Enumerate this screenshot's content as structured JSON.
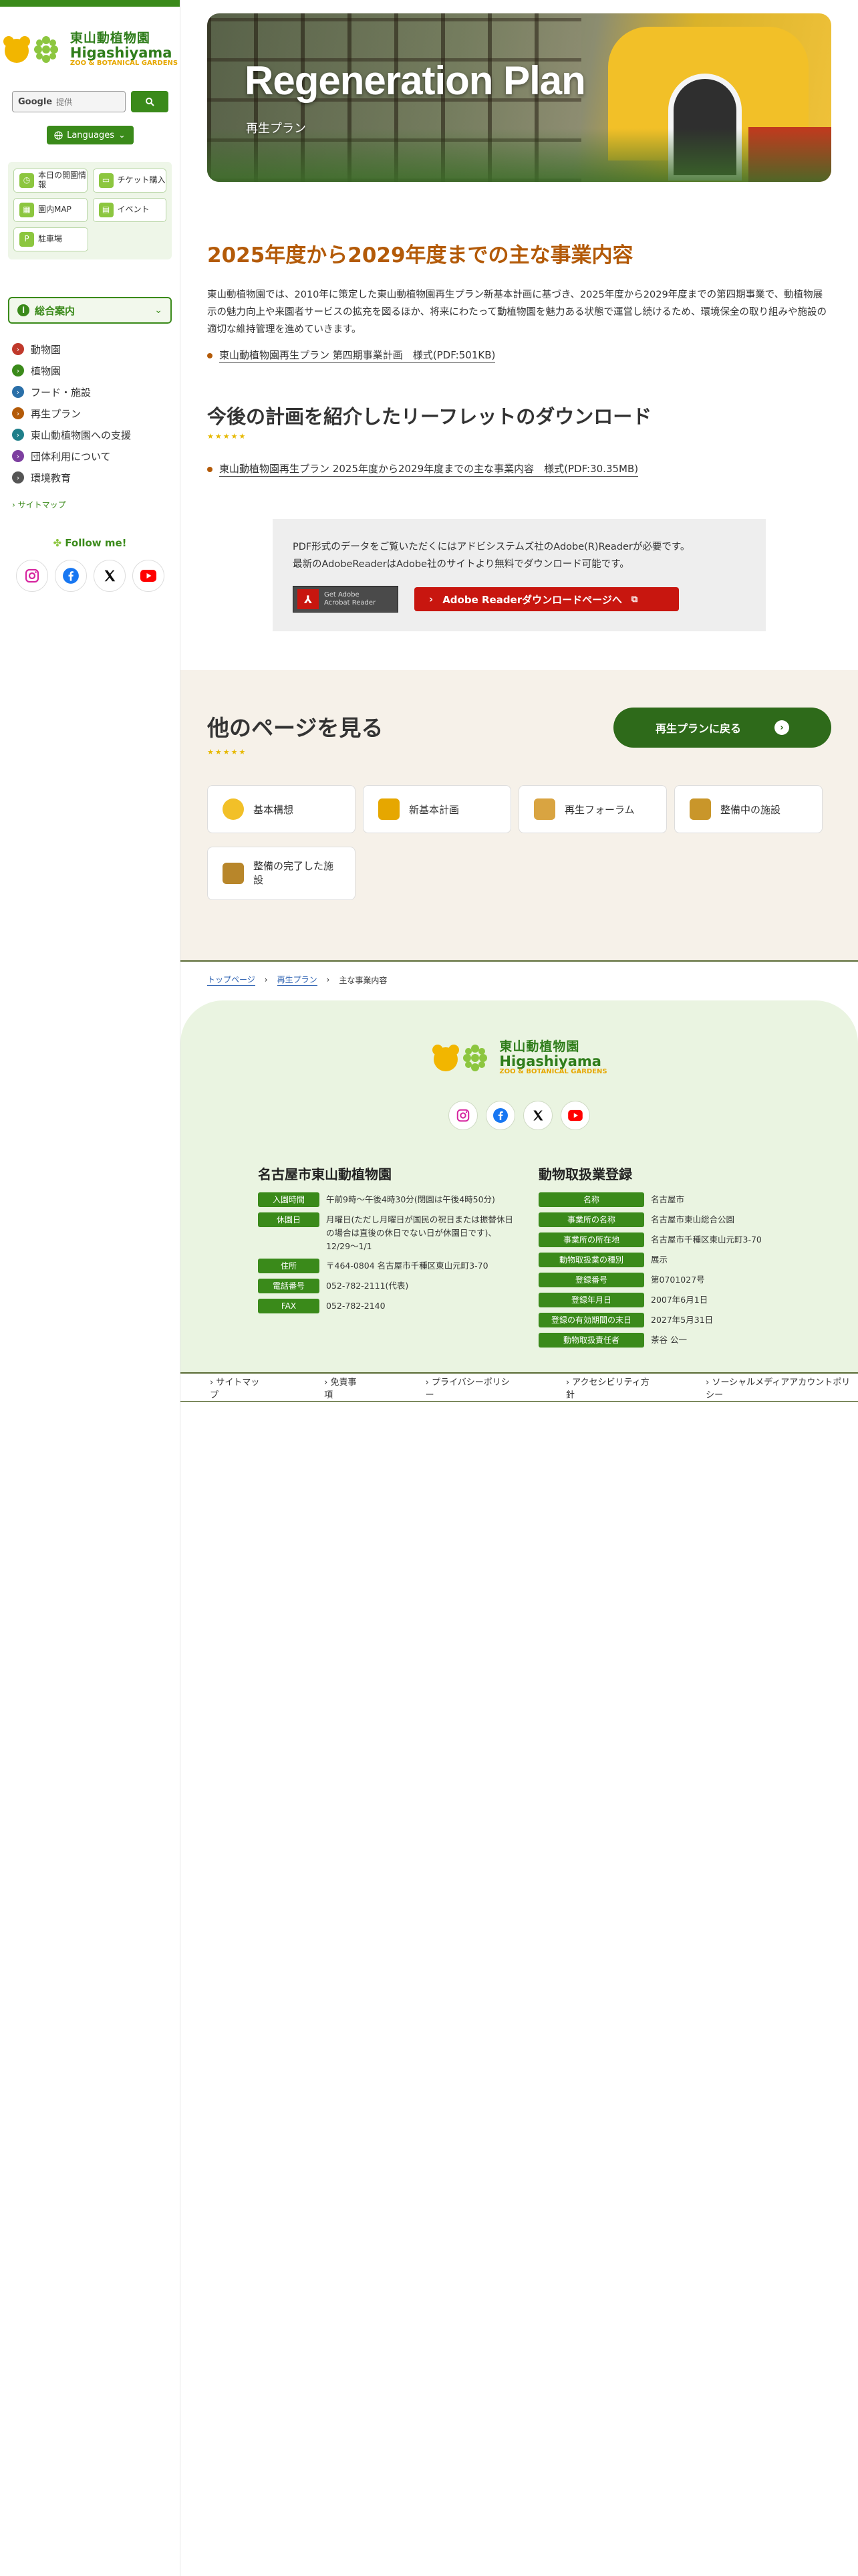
{
  "brand": {
    "jp": "東山動植物園",
    "en": "Higashiyama",
    "sub": "ZOO & BOTANICAL GARDENS"
  },
  "search": {
    "google": "Google",
    "placeholder": "提供"
  },
  "languages": "Languages",
  "quick_links": [
    {
      "label": "本日の開園情報",
      "icon": "clock-icon"
    },
    {
      "label": "チケット購入",
      "icon": "ticket-icon"
    },
    {
      "label": "園内MAP",
      "icon": "map-icon"
    },
    {
      "label": "イベント",
      "icon": "calendar-icon"
    },
    {
      "label": "駐車場",
      "icon": "parking-icon"
    }
  ],
  "general": "総合案内",
  "nav": [
    {
      "label": "動物園",
      "color": "#c0392b"
    },
    {
      "label": "植物園",
      "color": "#3a8a1a"
    },
    {
      "label": "フード・施設",
      "color": "#2a6fa8"
    },
    {
      "label": "再生プラン",
      "color": "#b35a08"
    },
    {
      "label": "東山動植物園への支援",
      "color": "#1f7f8a"
    },
    {
      "label": "団体利用について",
      "color": "#7d3fa0"
    },
    {
      "label": "環境教育",
      "color": "#555555"
    }
  ],
  "sitemap": "サイトマップ",
  "follow": "Follow me!",
  "hero": {
    "title": "Regeneration Plan",
    "subtitle": "再生プラン"
  },
  "section1": {
    "title": "2025年度から2029年度までの主な事業内容",
    "intro": "東山動植物園では、2010年に策定した東山動植物園再生プラン新基本計画に基づき、2025年度から2029年度までの第四期事業で、動植物展示の魅力向上や来園者サービスの拡充を図るほか、将来にわたって動植物園を魅力ある状態で運営し続けるため、環境保全の取り組みや施設の適切な維持管理を進めていきます。",
    "link": "東山動植物園再生プラン 第四期事業計画　様式(PDF:501KB)"
  },
  "section2": {
    "title": "今後の計画を紹介したリーフレットのダウンロード",
    "link": "東山動植物園再生プラン 2025年度から2029年度までの主な事業内容　様式(PDF:30.35MB)"
  },
  "adobe": {
    "line1": "PDF形式のデータをご覧いただくにはアドビシステムズ社のAdobe(R)Readerが必要です。",
    "line2": "最新のAdobeReaderはAdobe社のサイトより無料でダウンロード可能です。",
    "badge1": "Get Adobe",
    "badge2": "Acrobat Reader",
    "button": "Adobe Readerダウンロードページへ"
  },
  "other": {
    "title": "他のページを見る",
    "back": "再生プランに戻る",
    "cards": [
      {
        "label": "基本構想",
        "color": "#f2c028"
      },
      {
        "label": "新基本計画",
        "color": "#e6a700"
      },
      {
        "label": "再生フォーラム",
        "color": "#d9a441"
      },
      {
        "label": "整備中の施設",
        "color": "#c9962a"
      },
      {
        "label": "整備の完了した施設",
        "color": "#b8862a"
      }
    ]
  },
  "breadcrumb": {
    "home": "トップページ",
    "parent": "再生プラン",
    "current": "主な事業内容"
  },
  "footer": {
    "col1": {
      "title": "名古屋市東山動植物園",
      "rows": [
        {
          "k": "入園時間",
          "v": "午前9時〜午後4時30分(閉園は午後4時50分)"
        },
        {
          "k": "休園日",
          "v": "月曜日(ただし月曜日が国民の祝日または振替休日の場合は直後の休日でない日が休園日です)、12/29〜1/1"
        },
        {
          "k": "住所",
          "v": "〒464-0804 名古屋市千種区東山元町3-70"
        },
        {
          "k": "電話番号",
          "v": "052-782-2111(代表)"
        },
        {
          "k": "FAX",
          "v": "052-782-2140"
        }
      ]
    },
    "col2": {
      "title": "動物取扱業登録",
      "rows": [
        {
          "k": "名称",
          "v": "名古屋市"
        },
        {
          "k": "事業所の名称",
          "v": "名古屋市東山総合公園"
        },
        {
          "k": "事業所の所在地",
          "v": "名古屋市千種区東山元町3-70"
        },
        {
          "k": "動物取扱業の種別",
          "v": "展示"
        },
        {
          "k": "登録番号",
          "v": "第0701027号"
        },
        {
          "k": "登録年月日",
          "v": "2007年6月1日"
        },
        {
          "k": "登録の有効期間の末日",
          "v": "2027年5月31日"
        },
        {
          "k": "動物取扱責任者",
          "v": "茶谷 公一"
        }
      ]
    },
    "links": [
      "サイトマップ",
      "免責事項",
      "プライバシーポリシー",
      "アクセシビリティ方針",
      "ソーシャルメディアアカウントポリシー"
    ]
  }
}
